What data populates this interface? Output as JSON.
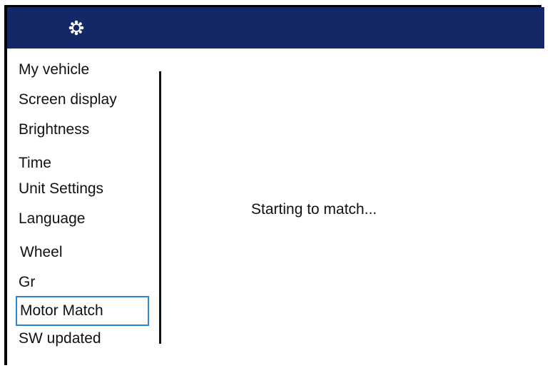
{
  "header": {
    "icon": "gear-icon",
    "background_color": "#142766"
  },
  "menu": {
    "items": [
      {
        "label": "My vehicle"
      },
      {
        "label": "Screen display"
      },
      {
        "label": "Brightness"
      },
      {
        "label": "Time"
      },
      {
        "label": "Unit Settings"
      },
      {
        "label": "Language"
      },
      {
        "label": "Wheel"
      },
      {
        "label": "Gr"
      },
      {
        "label": "Motor Match",
        "selected": true
      },
      {
        "label": "SW updated"
      }
    ],
    "selection_color": "#2f86d8"
  },
  "main": {
    "status_text": "Starting to match..."
  }
}
